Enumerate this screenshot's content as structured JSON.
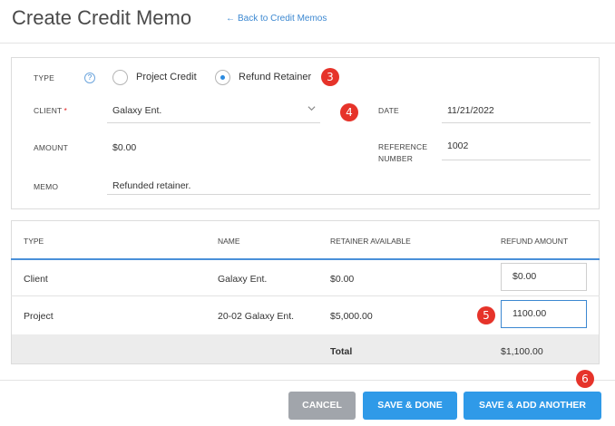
{
  "header": {
    "title": "Create Credit Memo",
    "back_link": "Back to Credit Memos"
  },
  "form": {
    "type_label": "TYPE",
    "help_glyph": "?",
    "type_options": [
      {
        "label": "Project Credit",
        "selected": false
      },
      {
        "label": "Refund Retainer",
        "selected": true
      }
    ],
    "client_label": "CLIENT",
    "client_value": "Galaxy Ent.",
    "date_label": "DATE",
    "date_value": "11/21/2022",
    "amount_label": "AMOUNT",
    "amount_value": "$0.00",
    "reference_label_line1": "REFERENCE",
    "reference_label_line2": "NUMBER",
    "reference_value": "1002",
    "memo_label": "MEMO",
    "memo_value": "Refunded retainer."
  },
  "table": {
    "headers": [
      "TYPE",
      "NAME",
      "RETAINER AVAILABLE",
      "REFUND AMOUNT"
    ],
    "rows": [
      {
        "type": "Client",
        "name": "Galaxy Ent.",
        "retainer": "$0.00",
        "refund": "$0.00"
      },
      {
        "type": "Project",
        "name": "20-02 Galaxy Ent.",
        "retainer": "$5,000.00",
        "refund": "1100.00"
      }
    ],
    "total_label": "Total",
    "total_value": "$1,100.00"
  },
  "badges": [
    "3",
    "4",
    "5",
    "6"
  ],
  "buttons": {
    "cancel": "CANCEL",
    "save_done": "SAVE & DONE",
    "save_add": "SAVE & ADD ANOTHER"
  },
  "colors": {
    "accent": "#2f9ae8",
    "badge": "#e6332a",
    "cancel": "#a1a5ab"
  }
}
